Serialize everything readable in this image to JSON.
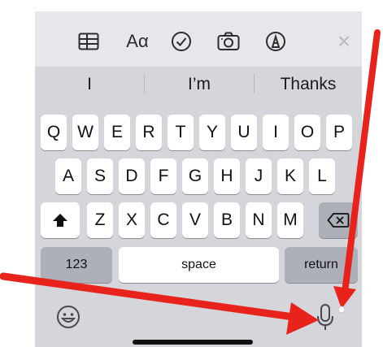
{
  "toolbar": {
    "icons": [
      "table-icon",
      "text-format-icon",
      "checklist-icon",
      "camera-icon",
      "markup-icon",
      "close-icon"
    ],
    "text_format_label": "Aα",
    "close_label": "×"
  },
  "suggestions": [
    "I",
    "I’m",
    "Thanks"
  ],
  "keys": {
    "row1": [
      "Q",
      "W",
      "E",
      "R",
      "T",
      "Y",
      "U",
      "I",
      "O",
      "P"
    ],
    "row2": [
      "A",
      "S",
      "D",
      "F",
      "G",
      "H",
      "J",
      "K",
      "L"
    ],
    "row3": [
      "Z",
      "X",
      "C",
      "V",
      "B",
      "N",
      "M"
    ],
    "numbers_label": "123",
    "space_label": "space",
    "return_label": "return"
  },
  "icons": {
    "shift": "shift-icon",
    "delete": "delete-icon",
    "emoji": "emoji-icon",
    "dictation": "microphone-icon"
  },
  "colors": {
    "annotation_arrow": "#e8231c",
    "keyboard_background": "#d4d6dc",
    "key_background": "#ffffff",
    "function_key_background": "#adb0b8"
  }
}
